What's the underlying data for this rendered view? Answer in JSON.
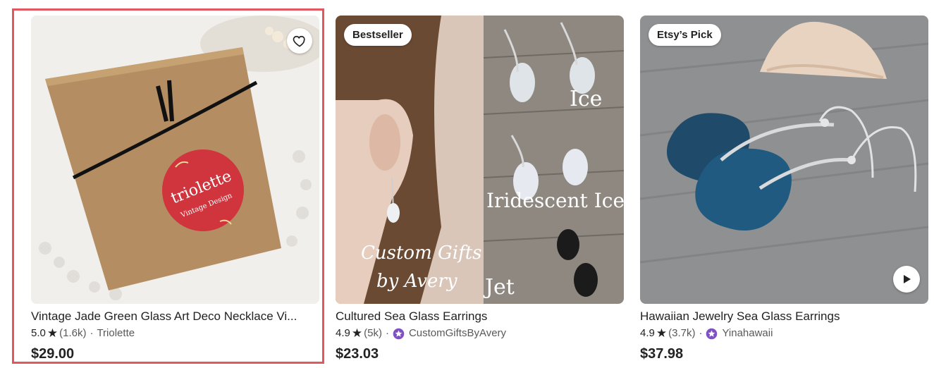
{
  "listings": [
    {
      "title": "Vintage Jade Green Glass Art Deco Necklace Vi...",
      "rating": "5.0",
      "reviews": "(1.6k)",
      "seller": "Triolette",
      "price": "$29.00",
      "sticker_text": "triolette",
      "sticker_sub": "Vintage Design"
    },
    {
      "badge": "Bestseller",
      "title": "Cultured Sea Glass Earrings",
      "rating": "4.9",
      "reviews": "(5k)",
      "seller": "CustomGiftsByAvery",
      "price": "$23.03",
      "overlay_ice": "Ice",
      "overlay_iridescent": "Iridescent Ice",
      "overlay_jet": "Jet",
      "overlay_script_1": "Custom Gifts",
      "overlay_script_2": "by Avery"
    },
    {
      "badge": "Etsy’s Pick",
      "title": "Hawaiian Jewelry Sea Glass Earrings",
      "rating": "4.9",
      "reviews": "(3.7k)",
      "seller": "Yinahawaii",
      "price": "$37.98"
    }
  ],
  "icons": {
    "favorite": "heart-outline-icon",
    "star": "star-icon",
    "star_seller": "star-seller-badge-icon",
    "video": "play-icon"
  },
  "colors": {
    "highlight_border": "#e2565d",
    "star_seller_purple": "#7f51c2",
    "text": "#222222",
    "muted": "#595959"
  }
}
